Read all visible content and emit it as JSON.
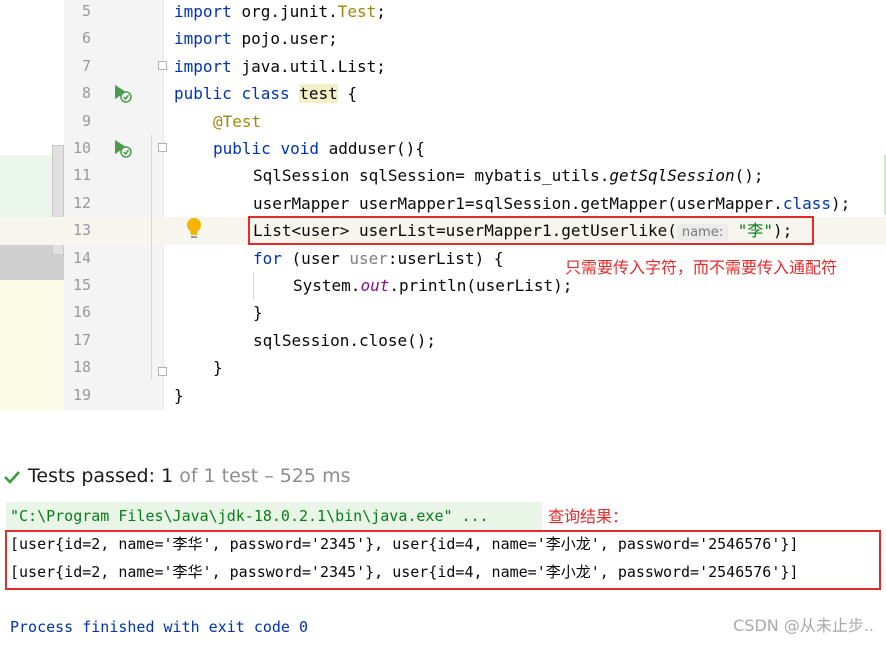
{
  "editor": {
    "line_numbers": [
      "5",
      "6",
      "7",
      "8",
      "9",
      "10",
      "11",
      "12",
      "13",
      "14",
      "15",
      "16",
      "17",
      "18",
      "19"
    ],
    "line5": {
      "kw": "import",
      "pkg": "org.junit.",
      "cls": "Test",
      "end": ";"
    },
    "line6": {
      "kw": "import",
      "rest": "pojo.user;"
    },
    "line7": {
      "kw": "import",
      "rest": "java.util.List;"
    },
    "line8": {
      "kw1": "public",
      "kw2": "class",
      "name": "test",
      "end": "{"
    },
    "line9": {
      "ann": "@Test"
    },
    "line10": {
      "kw1": "public",
      "kw2": "void",
      "rest": "adduser(){"
    },
    "line11": {
      "a": "SqlSession sqlSession= mybatis_utils.",
      "b": "getSqlSession",
      "c": "();"
    },
    "line12": {
      "a": "userMapper userMapper1=sqlSession.getMapper(userMapper.",
      "b": "class",
      "c": ");"
    },
    "line13": {
      "a": "List<user> userList=userMapper1.getUserlike(",
      "hint": "name:",
      "str": "\"李\"",
      "c": ");"
    },
    "line14": {
      "kw": "for",
      "a": "(user ",
      "unused": "user",
      "b": ":userList) {"
    },
    "line15": {
      "a": "System.",
      "fld": "out",
      "b": ".println(userList);"
    },
    "line16": {
      "text": "}"
    },
    "line17": {
      "text": "sqlSession.close();"
    },
    "line18": {
      "text": "}"
    },
    "line19": {
      "text": "}"
    },
    "annotation_note": "只需要传入字符，而不需要传入通配符"
  },
  "tests": {
    "status_label": "Tests passed:",
    "passed": "1",
    "of_label": "of 1 test",
    "duration": "– 525 ms"
  },
  "console": {
    "command": "\"C:\\Program Files\\Java\\jdk-18.0.2.1\\bin\\java.exe\" ...",
    "result_note": "查询结果：",
    "output_lines": [
      "[user{id=2, name='李华', password='2345'}, user{id=4, name='李小龙', password='2546576'}]",
      "[user{id=2, name='李华', password='2345'}, user{id=4, name='李小龙', password='2546576'}]"
    ],
    "exit_message": "Process finished with exit code 0"
  },
  "watermark": "CSDN @从未止步..",
  "colors": {
    "keyword": "#0033b3",
    "string": "#067d17",
    "annotation": "#9e880d",
    "highlight_box": "#e52a2a",
    "pass_green": "#3a9b3a"
  }
}
